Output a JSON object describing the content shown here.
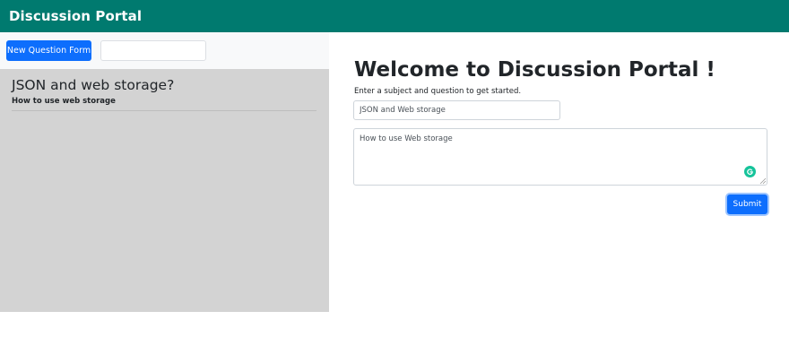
{
  "app": {
    "title": "Discussion Portal"
  },
  "sidebar": {
    "new_question_label": "New Question Form",
    "search": {
      "value": "",
      "placeholder": ""
    },
    "questions": [
      {
        "title": "JSON and web storage?",
        "body": "How to use web storage"
      }
    ]
  },
  "main": {
    "heading": "Welcome to Discussion Portal !",
    "subtext": "Enter a subject and question to get started.",
    "subject": {
      "value": "JSON and Web storage"
    },
    "question": {
      "value": "How to use Web storage"
    },
    "submit_label": "Submit"
  },
  "colors": {
    "navbar": "#007a6f",
    "primary": "#0d6efd",
    "sidebar_list_bg": "#d3d3d3",
    "grammarly": "#15c39a"
  },
  "icons": [
    "grammarly-icon",
    "resize-handle-icon"
  ]
}
